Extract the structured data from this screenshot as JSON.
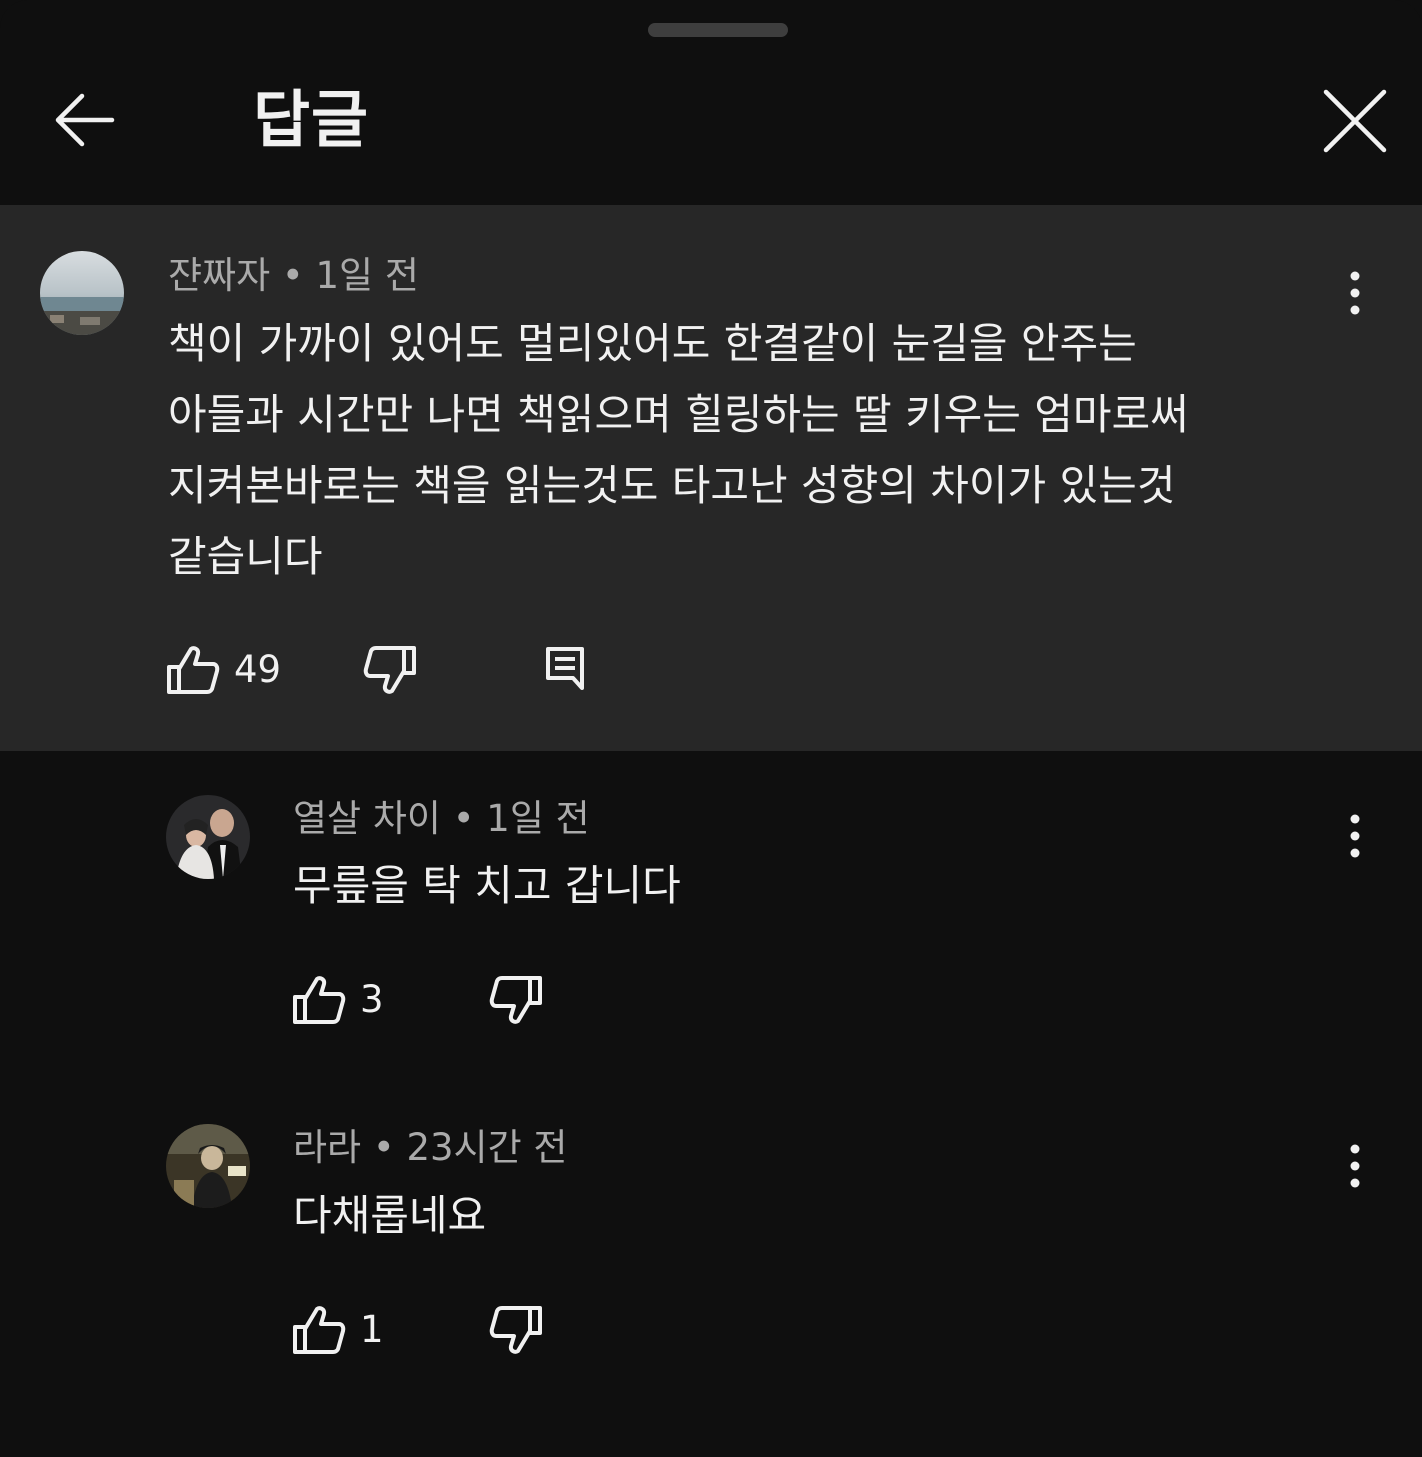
{
  "header": {
    "title": "답글"
  },
  "parent_comment": {
    "author": "쟌짜자",
    "time": "1일 전",
    "text_lines": [
      "책이 가까이 있어도 멀리있어도 한결같이 눈길을 안주는",
      "아들과 시간만 나면 책읽으며 힐링하는 딸 키우는 엄마로써",
      "지켜본바로는 책을 읽는것도 타고난 성향의 차이가 있는것",
      "같습니다"
    ],
    "likes": "49"
  },
  "replies": [
    {
      "author": "열살 차이",
      "time": "1일 전",
      "text": "무릎을 탁 치고 갑니다",
      "likes": "3"
    },
    {
      "author": "라라",
      "time": "23시간 전",
      "text": "다채롭네요",
      "likes": "1"
    }
  ],
  "separator": "•",
  "colors": {
    "background": "#0f0f0f",
    "highlight": "#272727",
    "text_primary": "#f1f1f1",
    "text_secondary": "#aaaaaa"
  },
  "icons": [
    "back-arrow-icon",
    "close-icon",
    "more-vert-icon",
    "thumb-up-icon",
    "thumb-down-icon",
    "reply-icon"
  ]
}
